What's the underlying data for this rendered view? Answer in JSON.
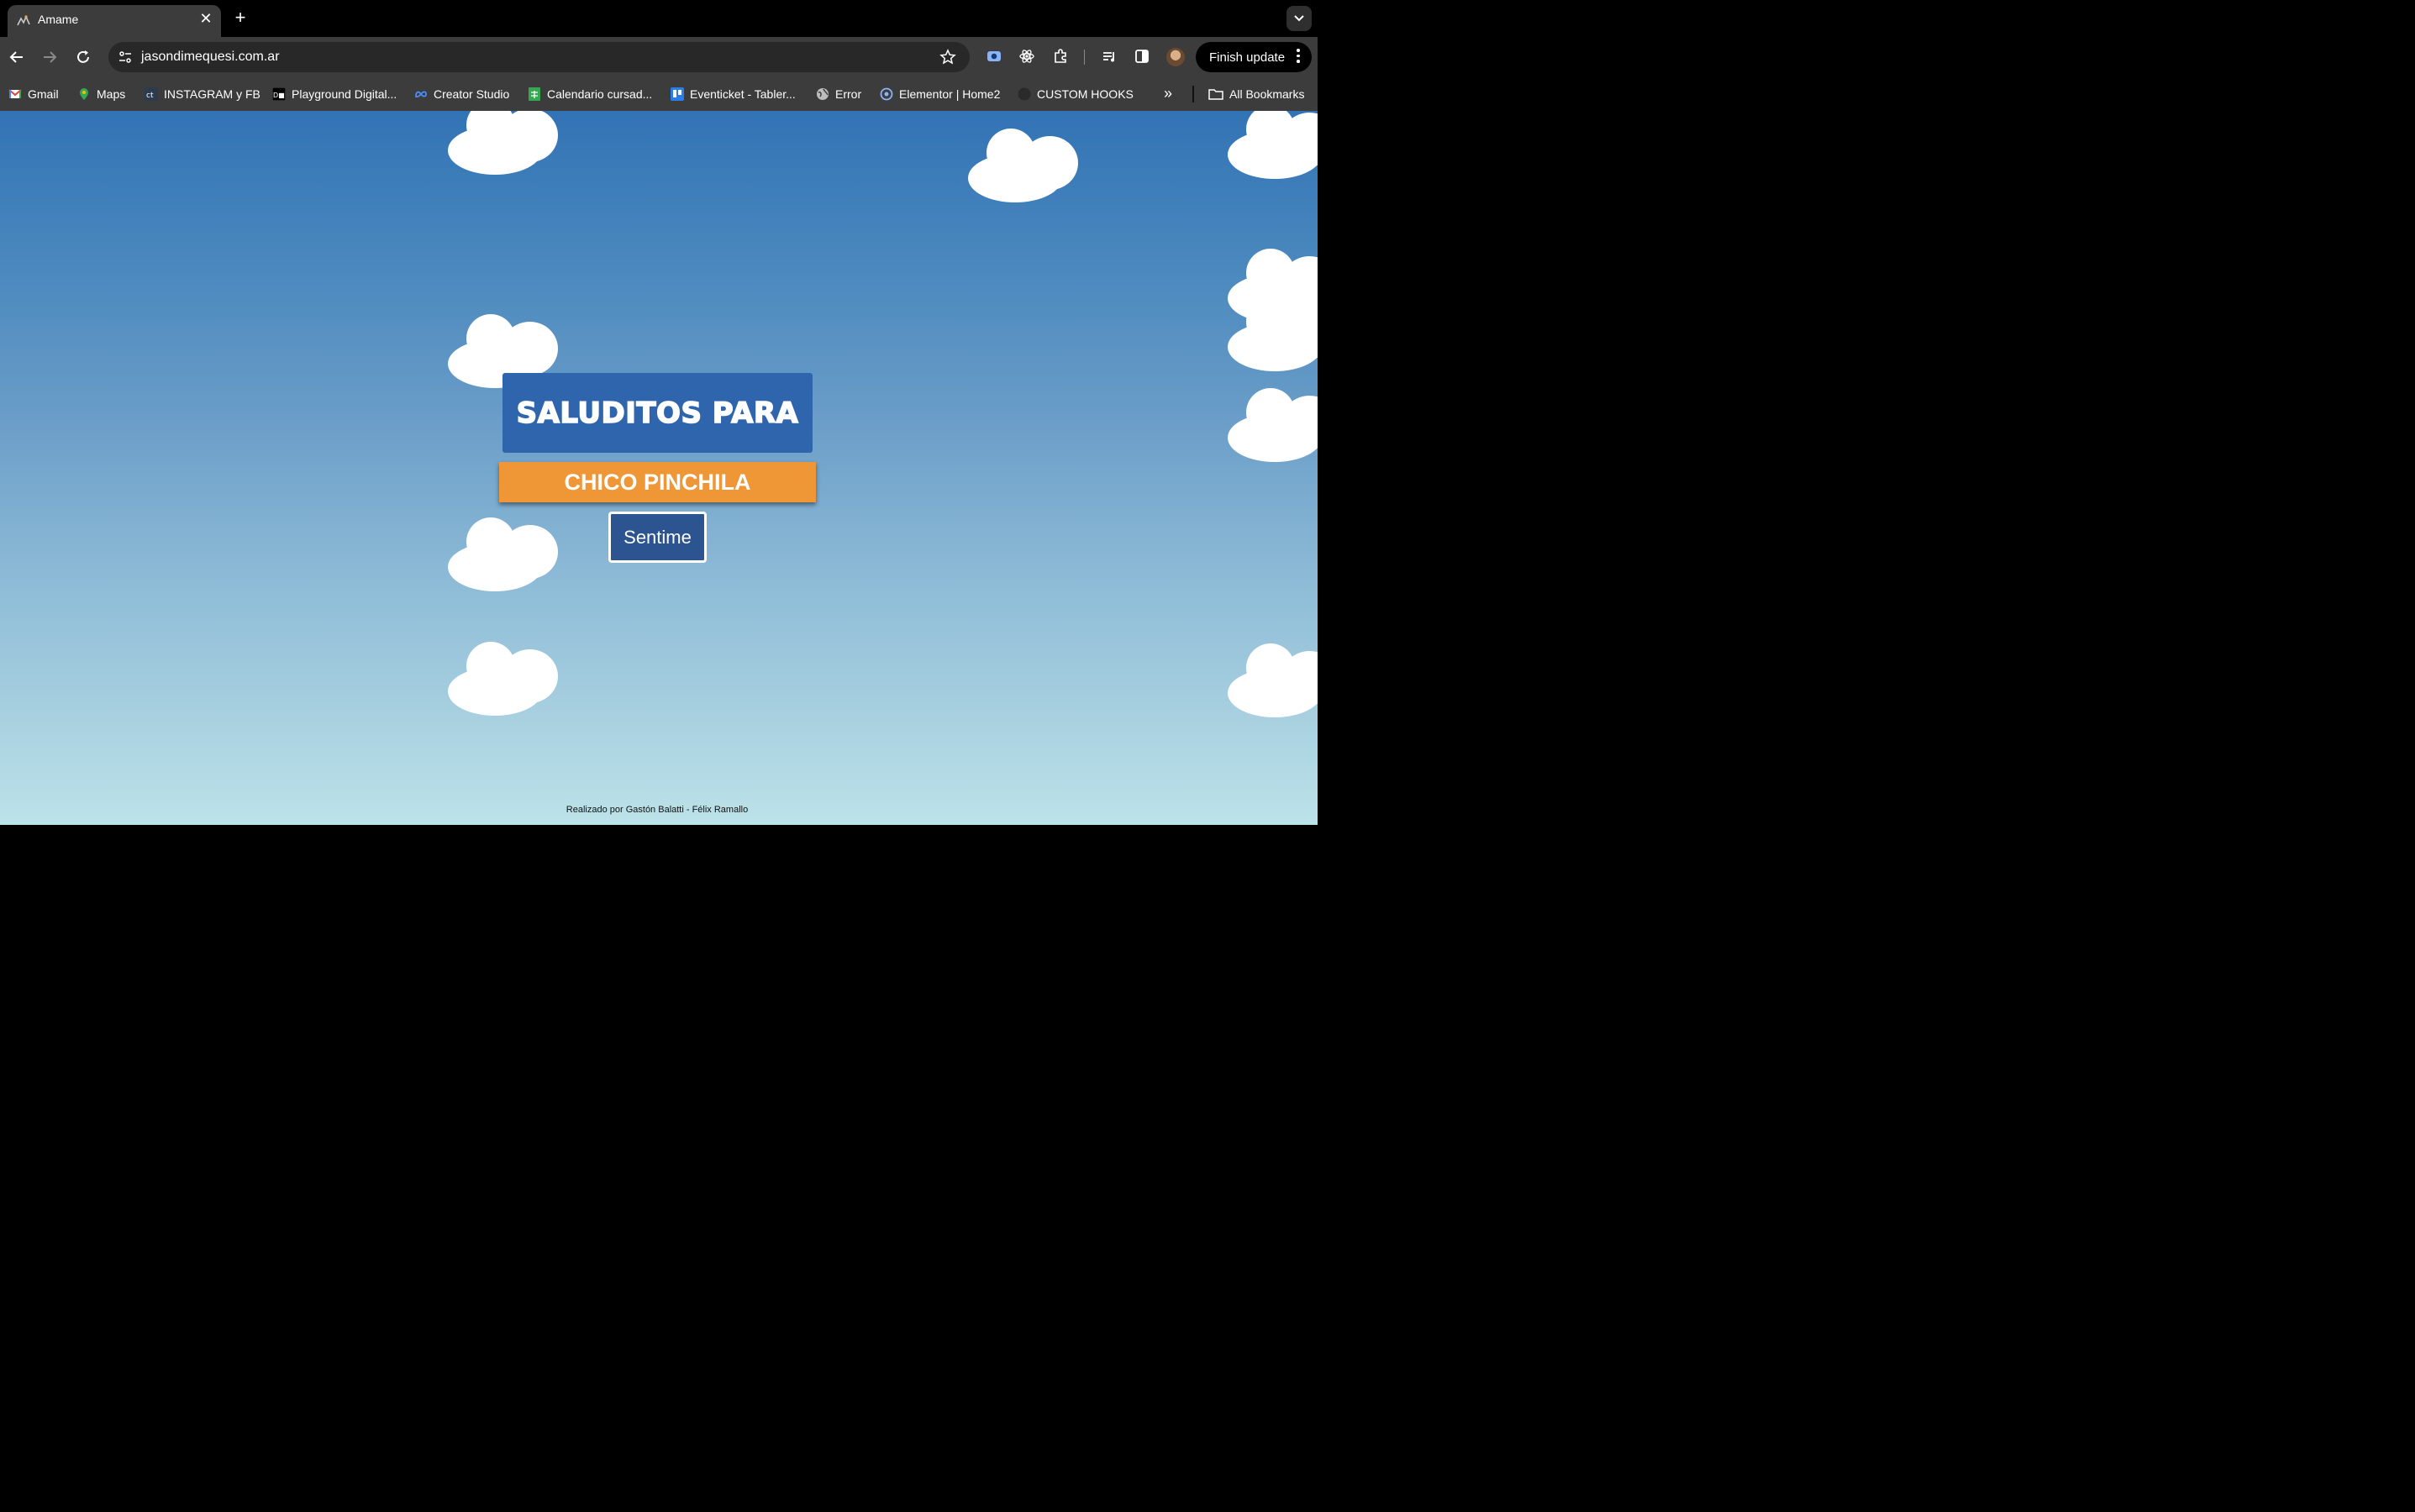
{
  "browser": {
    "tab": {
      "title": "Amame",
      "close": "✕"
    },
    "new_tab": "+",
    "url": "jasondimequesi.com.ar",
    "finish_update": "Finish update"
  },
  "bookmarks": [
    {
      "label": "Gmail",
      "icon": "gmail-icon"
    },
    {
      "label": "Maps",
      "icon": "maps-icon"
    },
    {
      "label": "INSTAGRAM y FB",
      "icon": "ct-icon"
    },
    {
      "label": "Playground Digital...",
      "icon": "dh-icon"
    },
    {
      "label": "Creator Studio",
      "icon": "meta-icon"
    },
    {
      "label": "Calendario cursad...",
      "icon": "sheets-icon"
    },
    {
      "label": "Eventicket - Tabler...",
      "icon": "trello-icon"
    },
    {
      "label": "Error",
      "icon": "globe-icon"
    },
    {
      "label": "Elementor | Home2",
      "icon": "elementor-icon"
    },
    {
      "label": "CUSTOM HOOKS",
      "icon": "github-icon"
    }
  ],
  "all_bookmarks": "All Bookmarks",
  "page": {
    "heading": "SALUDITOS PARA",
    "name": "CHICO PINCHILA",
    "button": "Sentime",
    "credit": "Realizado por Gastón Balatti - Félix Ramallo"
  },
  "colors": {
    "title_box": "#2f65ad",
    "name_box": "#ef9636",
    "button": "#2b5490",
    "sky_top": "#3273b5",
    "sky_bottom": "#bce3e9"
  }
}
